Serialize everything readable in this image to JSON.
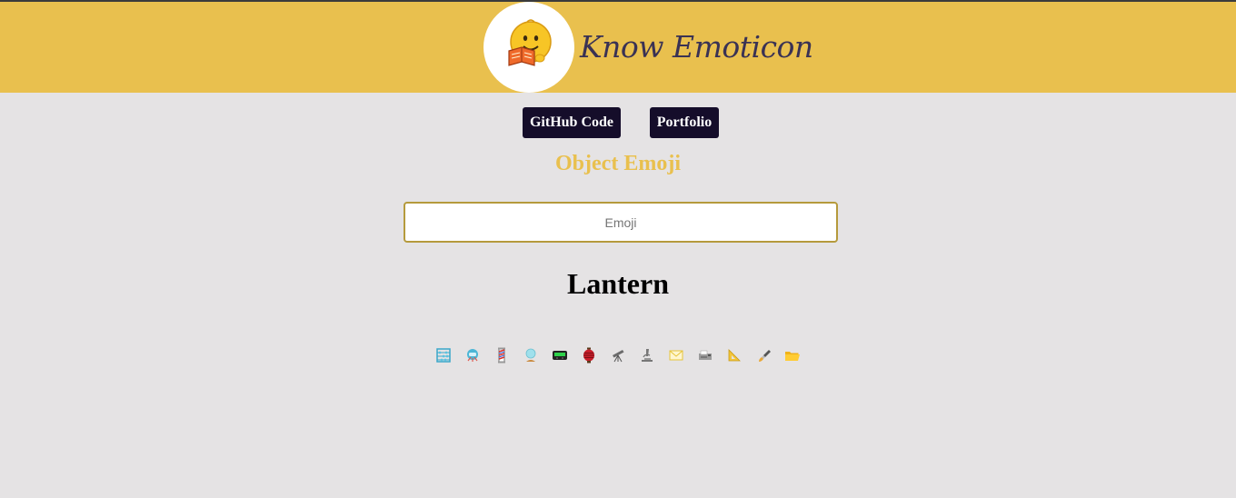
{
  "header": {
    "brand": "Know Emoticon",
    "logo_icon": "reading-smiley-icon"
  },
  "nav": {
    "github_label": "GitHub Code",
    "portfolio_label": "Portfolio"
  },
  "main": {
    "section_title": "Object Emoji",
    "search_placeholder": "Emoji",
    "search_value": "",
    "meaning": "Lantern"
  },
  "emojis": [
    {
      "icon": "abacus-icon"
    },
    {
      "icon": "diving-mask-icon"
    },
    {
      "icon": "barber-pole-icon"
    },
    {
      "icon": "crystal-ball-icon"
    },
    {
      "icon": "pager-icon"
    },
    {
      "icon": "red-paper-lantern-icon"
    },
    {
      "icon": "telescope-icon"
    },
    {
      "icon": "microscope-icon"
    },
    {
      "icon": "envelope-icon"
    },
    {
      "icon": "fax-machine-icon"
    },
    {
      "icon": "triangular-ruler-icon"
    },
    {
      "icon": "paintbrush-icon"
    },
    {
      "icon": "open-folder-icon"
    }
  ],
  "colors": {
    "banner": "#e9c04e",
    "background": "#e5e3e4",
    "button": "#150d2a",
    "accent_text": "#e9c04e"
  }
}
